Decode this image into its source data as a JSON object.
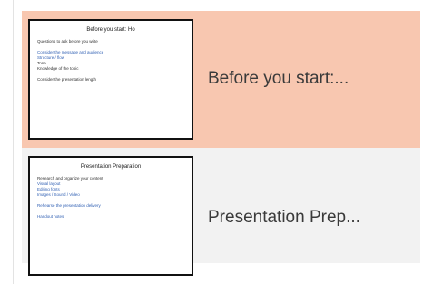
{
  "slides": [
    {
      "label": "Before you start:...",
      "selected": true,
      "thumb_title": "Before you start: Ho",
      "thumb_lines": [
        "Questions to ask before you write",
        "Consider the message and audience",
        "Structure / flow",
        "Tone",
        "Knowledge of the topic",
        "Consider the presentation length"
      ]
    },
    {
      "label": "Presentation Prep...",
      "selected": false,
      "thumb_title": "Presentation Preparation",
      "thumb_lines": [
        "Research and organize your content",
        "Visual layout",
        "Editing fonts",
        "Images / Sound / Video",
        "Rehearse the presentation delivery",
        "Handout notes"
      ]
    }
  ],
  "colors": {
    "selected_bg": "#f8c7b0",
    "normal_bg": "#f2f2f2",
    "thumb_border": "#111111"
  }
}
